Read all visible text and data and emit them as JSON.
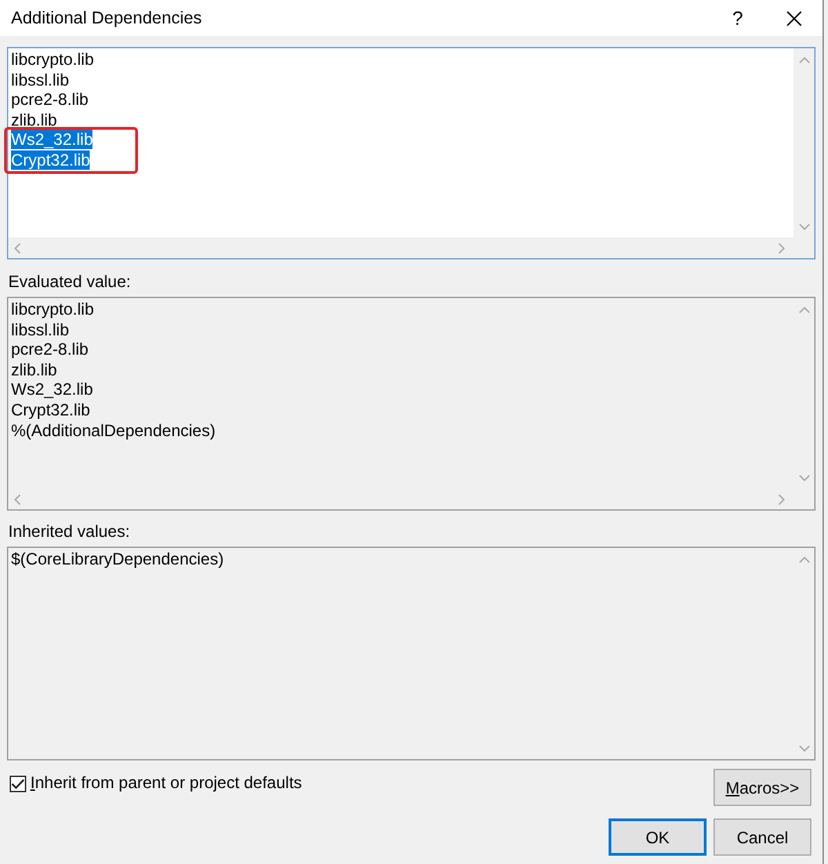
{
  "window": {
    "title": "Additional Dependencies",
    "help_button": "?"
  },
  "editor": {
    "lines": [
      {
        "text": "libcrypto.lib",
        "selected": false,
        "circled": false
      },
      {
        "text": "libssl.lib",
        "selected": false,
        "circled": false
      },
      {
        "text": "pcre2-8.lib",
        "selected": false,
        "circled": false
      },
      {
        "text": "zlib.lib",
        "selected": false,
        "circled": false
      },
      {
        "text": "Ws2_32.lib",
        "selected": true,
        "circled": true
      },
      {
        "text": "Crypt32.lib",
        "selected": true,
        "circled": true
      }
    ]
  },
  "evaluated": {
    "label": "Evaluated value:",
    "lines": [
      "libcrypto.lib",
      "libssl.lib",
      "pcre2-8.lib",
      "zlib.lib",
      "Ws2_32.lib",
      "Crypt32.lib",
      "%(AdditionalDependencies)"
    ]
  },
  "inherited": {
    "label": "Inherited values:",
    "lines": [
      "$(CoreLibraryDependencies)"
    ]
  },
  "inherit_checkbox": {
    "label": "Inherit from parent or project defaults",
    "checked": true
  },
  "macros_button": {
    "label": "Macros>>"
  },
  "buttons": [
    {
      "label": "OK",
      "kind": "default"
    },
    {
      "label": "Cancel",
      "kind": "normal"
    }
  ]
}
